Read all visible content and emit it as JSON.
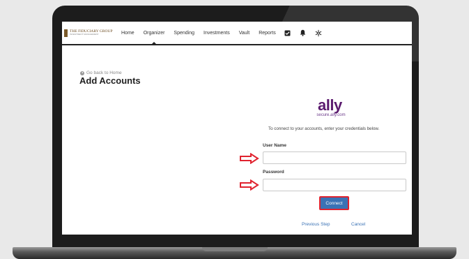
{
  "brand": {
    "name": "THE FIDUCIARY GROUP",
    "tagline": "INVESTMENT MANAGEMENT"
  },
  "nav": {
    "items": [
      "Home",
      "Organizer",
      "Spending",
      "Investments",
      "Vault",
      "Reports"
    ],
    "active": "Organizer",
    "icons": [
      "checkbox-icon",
      "bell-icon",
      "settings-asterisk-icon"
    ]
  },
  "page": {
    "back_link": "Go back to Home",
    "title": "Add Accounts"
  },
  "provider": {
    "logo": "ally",
    "url": "secure.ally.com",
    "brand_color": "#5a1a6e"
  },
  "form": {
    "instructions": "To connect to your accounts, enter your credentials below.",
    "username_label": "User Name",
    "username_value": "",
    "password_label": "Password",
    "password_value": "",
    "connect_label": "Connect",
    "previous_label": "Previous Step",
    "cancel_label": "Cancel"
  },
  "colors": {
    "accent": "#3a72b5",
    "highlight": "#e0232f"
  }
}
